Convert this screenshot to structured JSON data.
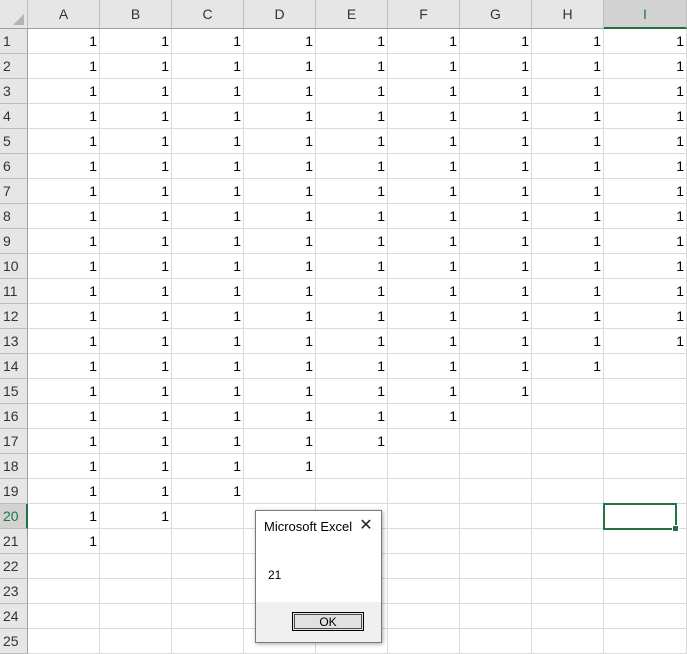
{
  "sheet": {
    "columns": [
      "A",
      "B",
      "C",
      "D",
      "E",
      "F",
      "G",
      "H",
      "I"
    ],
    "active_column": "I",
    "rows": [
      "1",
      "2",
      "3",
      "4",
      "5",
      "6",
      "7",
      "8",
      "9",
      "10",
      "11",
      "12",
      "13",
      "14",
      "15",
      "16",
      "17",
      "18",
      "19",
      "20",
      "21",
      "22",
      "23",
      "24",
      "25"
    ],
    "active_row": "20",
    "column_fill_counts": [
      21,
      20,
      19,
      18,
      17,
      16,
      15,
      14,
      13
    ],
    "cell_value": "1",
    "selected_cell": "I20"
  },
  "dialog": {
    "title": "Microsoft Excel",
    "close_glyph": "✕",
    "message": "21",
    "ok_label": "OK"
  }
}
